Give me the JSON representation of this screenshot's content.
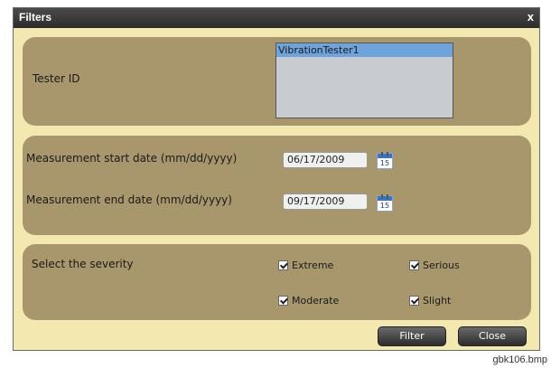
{
  "window": {
    "title": "Filters",
    "close_label": "x"
  },
  "tester": {
    "label": "Tester ID",
    "items": [
      "VibrationTester1"
    ]
  },
  "dates": {
    "start_label": "Measurement start date (mm/dd/yyyy)",
    "start_value": "06/17/2009",
    "end_label": "Measurement end date (mm/dd/yyyy)",
    "end_value": "09/17/2009",
    "calendar_day": "15",
    "calendar_icon": "calendar-icon"
  },
  "severity": {
    "label": "Select the severity",
    "options": [
      {
        "label": "Extreme",
        "checked": true
      },
      {
        "label": "Serious",
        "checked": true
      },
      {
        "label": "Moderate",
        "checked": true
      },
      {
        "label": "Slight",
        "checked": true
      }
    ]
  },
  "buttons": {
    "filter": "Filter",
    "close": "Close"
  },
  "caption": "gbk106.bmp",
  "colors": {
    "window_bg": "#f3e8b0",
    "panel_bg": "#a8976c",
    "titlebar": "#3a3a3a",
    "selected_item": "#6ea3dc"
  }
}
